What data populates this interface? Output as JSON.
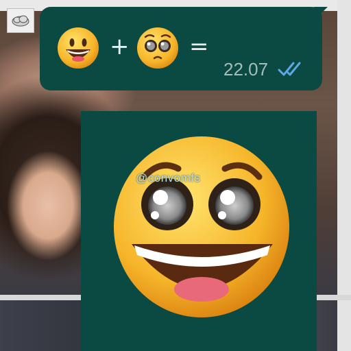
{
  "message": {
    "emoji_left": "grinning-face-emoji",
    "operator_plus": "+",
    "emoji_right": "pleading-face-emoji",
    "operator_equals": "=",
    "time": "22.07",
    "read_status": "double-check-read-icon"
  },
  "sticker": {
    "emoji": "pleading-grinning-combo-emoji",
    "watermark": "@convomfs"
  },
  "colors": {
    "bubble": "#0a4a43",
    "time_text": "#a7bdb9",
    "tick": "#5aa9e6",
    "emoji_yellow": "#f6b52a"
  }
}
